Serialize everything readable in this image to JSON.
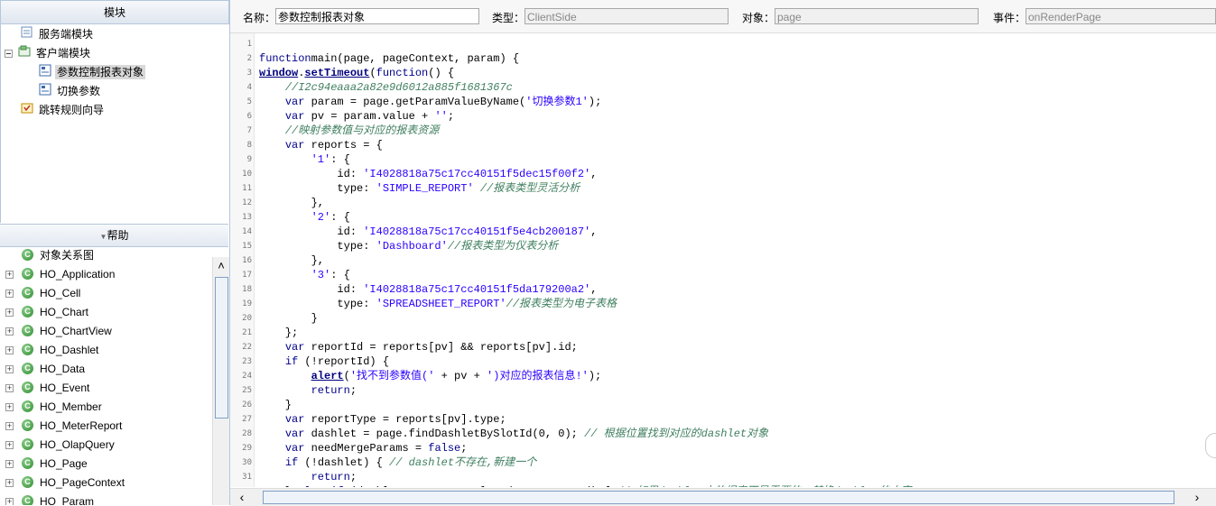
{
  "modules_panel": {
    "title": "模块",
    "items": [
      {
        "label": "服务端模块"
      },
      {
        "label": "客户端模块"
      },
      {
        "label": "参数控制报表对象"
      },
      {
        "label": "切换参数"
      },
      {
        "label": "跳转规则向导"
      }
    ]
  },
  "help_panel": {
    "title": "帮助",
    "items": [
      {
        "label": "对象关系图"
      },
      {
        "label": "HO_Application"
      },
      {
        "label": "HO_Cell"
      },
      {
        "label": "HO_Chart"
      },
      {
        "label": "HO_ChartView"
      },
      {
        "label": "HO_Dashlet"
      },
      {
        "label": "HO_Data"
      },
      {
        "label": "HO_Event"
      },
      {
        "label": "HO_Member"
      },
      {
        "label": "HO_MeterReport"
      },
      {
        "label": "HO_OlapQuery"
      },
      {
        "label": "HO_Page"
      },
      {
        "label": "HO_PageContext"
      },
      {
        "label": "HO_Param"
      }
    ]
  },
  "toolbar": {
    "name_label": "名称：",
    "name_value": "参数控制报表对象",
    "type_label": "类型：",
    "type_value": "ClientSide",
    "object_label": "对象：",
    "object_value": "page",
    "event_label": "事件：",
    "event_value": "onRenderPage"
  },
  "code": {
    "line_numbers": [
      "1",
      "2",
      "3",
      "4",
      "5",
      "6",
      "7",
      "8",
      "9",
      "10",
      "11",
      "12",
      "13",
      "14",
      "15",
      "16",
      "17",
      "18",
      "19",
      "20",
      "21",
      "22",
      "23",
      "24",
      "25",
      "26",
      "27",
      "28",
      "29",
      "30",
      "31"
    ],
    "lines": [
      [],
      [
        [
          "kw",
          "function"
        ],
        [
          "",
          "main(page, pageContext, param) {"
        ]
      ],
      [
        [
          "fn",
          "window"
        ],
        [
          "",
          "."
        ],
        [
          "fn",
          "setTimeout"
        ],
        [
          "",
          "("
        ],
        [
          "kw",
          "function"
        ],
        [
          "",
          "() {"
        ]
      ],
      [
        [
          "",
          "    "
        ],
        [
          "cm",
          "//I2c94eaaa2a82e9d6012a885f1681367c"
        ]
      ],
      [
        [
          "",
          "    "
        ],
        [
          "kw",
          "var"
        ],
        [
          "",
          " param = page.getParamValueByName("
        ],
        [
          "str",
          "'切换参数1'"
        ],
        [
          "",
          ");"
        ]
      ],
      [
        [
          "",
          "    "
        ],
        [
          "kw",
          "var"
        ],
        [
          "",
          " pv = param.value + "
        ],
        [
          "str",
          "''"
        ],
        [
          "",
          ";"
        ]
      ],
      [
        [
          "",
          "    "
        ],
        [
          "cm",
          "//映射参数值与对应的报表资源"
        ]
      ],
      [
        [
          "",
          "    "
        ],
        [
          "kw",
          "var"
        ],
        [
          "",
          " reports = {"
        ]
      ],
      [
        [
          "",
          "        "
        ],
        [
          "str",
          "'1'"
        ],
        [
          "",
          ": {"
        ]
      ],
      [
        [
          "",
          "            id: "
        ],
        [
          "str",
          "'I4028818a75c17cc40151f5dec15f00f2'"
        ],
        [
          "",
          ","
        ]
      ],
      [
        [
          "",
          "            type: "
        ],
        [
          "str",
          "'SIMPLE_REPORT'"
        ],
        [
          "",
          " "
        ],
        [
          "cm",
          "//报表类型灵活分析"
        ]
      ],
      [
        [
          "",
          "        },"
        ]
      ],
      [
        [
          "",
          "        "
        ],
        [
          "str",
          "'2'"
        ],
        [
          "",
          ": {"
        ]
      ],
      [
        [
          "",
          "            id: "
        ],
        [
          "str",
          "'I4028818a75c17cc40151f5e4cb200187'"
        ],
        [
          "",
          ","
        ]
      ],
      [
        [
          "",
          "            type: "
        ],
        [
          "str",
          "'Dashboard'"
        ],
        [
          "cm",
          "//报表类型为仪表分析"
        ]
      ],
      [
        [
          "",
          "        },"
        ]
      ],
      [
        [
          "",
          "        "
        ],
        [
          "str",
          "'3'"
        ],
        [
          "",
          ": {"
        ]
      ],
      [
        [
          "",
          "            id: "
        ],
        [
          "str",
          "'I4028818a75c17cc40151f5da179200a2'"
        ],
        [
          "",
          ","
        ]
      ],
      [
        [
          "",
          "            type: "
        ],
        [
          "str",
          "'SPREADSHEET_REPORT'"
        ],
        [
          "cm",
          "//报表类型为电子表格"
        ]
      ],
      [
        [
          "",
          "        }"
        ]
      ],
      [
        [
          "",
          "    };"
        ]
      ],
      [
        [
          "",
          "    "
        ],
        [
          "kw",
          "var"
        ],
        [
          "",
          " reportId = reports[pv] && reports[pv].id;"
        ]
      ],
      [
        [
          "",
          "    "
        ],
        [
          "kw",
          "if"
        ],
        [
          "",
          " (!reportId) {"
        ]
      ],
      [
        [
          "",
          "        "
        ],
        [
          "fn",
          "alert"
        ],
        [
          "",
          "("
        ],
        [
          "str",
          "'找不到参数值('"
        ],
        [
          "",
          " + pv + "
        ],
        [
          "str",
          "')对应的报表信息!'"
        ],
        [
          "",
          ");"
        ]
      ],
      [
        [
          "",
          "        "
        ],
        [
          "kw",
          "return"
        ],
        [
          "",
          ";"
        ]
      ],
      [
        [
          "",
          "    }"
        ]
      ],
      [
        [
          "",
          "    "
        ],
        [
          "kw",
          "var"
        ],
        [
          "",
          " reportType = reports[pv].type;"
        ]
      ],
      [
        [
          "",
          "    "
        ],
        [
          "kw",
          "var"
        ],
        [
          "",
          " dashlet = page.findDashletBySlotId(0, 0); "
        ],
        [
          "cm",
          "// 根据位置找到对应的dashlet对象"
        ]
      ],
      [
        [
          "",
          "    "
        ],
        [
          "kw",
          "var"
        ],
        [
          "",
          " needMergeParams = "
        ],
        [
          "kw",
          "false"
        ],
        [
          "",
          ";"
        ]
      ],
      [
        [
          "",
          "    "
        ],
        [
          "kw",
          "if"
        ],
        [
          "",
          " (!dashlet) { "
        ],
        [
          "cm",
          "// dashlet不存在,新建一个"
        ]
      ],
      [
        [
          "",
          "        "
        ],
        [
          "kw",
          "return"
        ],
        [
          "",
          ";"
        ]
      ],
      [
        [
          "",
          "    } "
        ],
        [
          "kw",
          "else if"
        ],
        [
          "",
          " (dashlet.currentPortletId != reportId) { "
        ],
        [
          "cm",
          "// 如果dashlet中的报表不是需要的，替换dashlet的内容"
        ]
      ]
    ]
  }
}
